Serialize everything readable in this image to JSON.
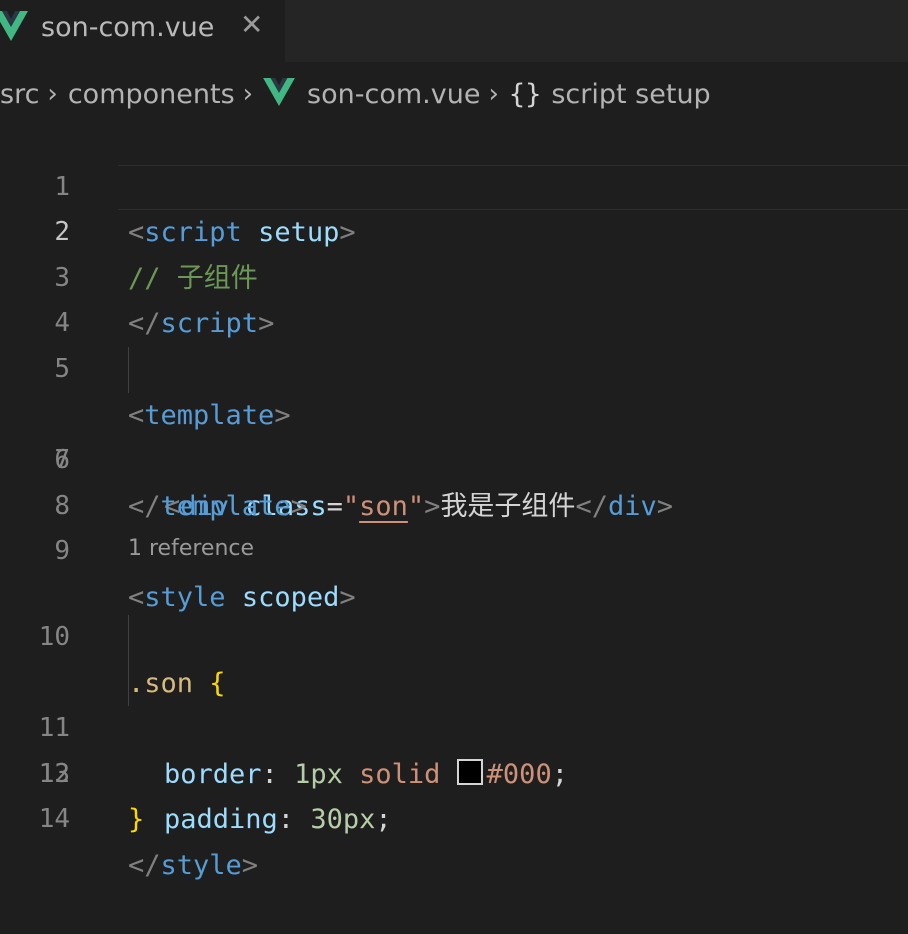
{
  "tab": {
    "label": "son-com.vue",
    "close": "✕",
    "icon": "vue-icon"
  },
  "breadcrumb": {
    "items": [
      "src",
      "components",
      "son-com.vue",
      "script setup"
    ],
    "separator": "›",
    "symbol": "{}"
  },
  "codelens": "1 reference",
  "colors": {
    "vue": "#41b883",
    "keyword": "#569cd6",
    "attribute": "#9cdcfe",
    "string": "#ce9178",
    "comment": "#6a9955",
    "selector": "#d7ba7d",
    "number": "#b5cea8"
  },
  "lines": {
    "n1": "1",
    "n2": "2",
    "n3": "3",
    "n4": "4",
    "n5": "5",
    "n6": "6",
    "n7": "7",
    "n8": "8",
    "n9": "9",
    "n10": "10",
    "n11": "11",
    "n12": "12",
    "n13": "13",
    "n14": "14",
    "l1": {
      "open": "<",
      "tag": "script",
      "attr": "setup",
      "close": ">"
    },
    "l2": "// 子组件",
    "l3": {
      "open": "</",
      "tag": "script",
      "close": ">"
    },
    "l5": {
      "open": "<",
      "tag": "template",
      "close": ">"
    },
    "l6": {
      "open": "<",
      "tag": "div",
      "attr": "class",
      "eq": "=",
      "q1": "\"",
      "value": "son",
      "q2": "\"",
      "close": ">",
      "text": "我是子组件",
      "endopen": "</",
      "endtag": "div",
      "endclose": ">"
    },
    "l7": {
      "open": "</",
      "tag": "template",
      "close": ">"
    },
    "l9": {
      "open": "<",
      "tag": "style",
      "attr": "scoped",
      "close": ">"
    },
    "l10": {
      "selector": ".son",
      "brace": "{"
    },
    "l11": {
      "prop": "border",
      "colon": ":",
      "num": "1px",
      "kw": "solid",
      "color": "#000",
      "semi": ";"
    },
    "l12": {
      "prop": "padding",
      "colon": ":",
      "num": "30px",
      "semi": ";"
    },
    "l13": "}",
    "l14": {
      "open": "</",
      "tag": "style",
      "close": ">"
    }
  }
}
